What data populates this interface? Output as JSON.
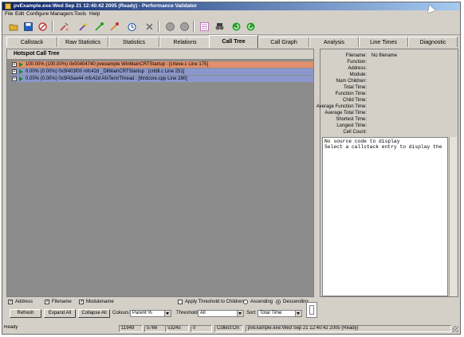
{
  "window": {
    "title": "pvExample.exe:Wed Sep 21 12:40:42 2005 (Ready) - Performance Validator"
  },
  "menu": [
    "File",
    "Edit",
    "Configure",
    "Managers",
    "Tools",
    "Help"
  ],
  "toolbar": {
    "buttons": [
      {
        "name": "open-icon",
        "color": "#e0b030"
      },
      {
        "name": "save-icon",
        "color": "#2060c0"
      },
      {
        "name": "launch-icon",
        "color": "#c03030"
      },
      {
        "name": "inject-icon",
        "color": "#c04040"
      },
      {
        "name": "wizard-icon",
        "color": "#6040a0"
      },
      {
        "name": "attach-icon",
        "color": "#20a020"
      },
      {
        "name": "attach-inject-icon",
        "color": "#e08020"
      },
      {
        "name": "timer-icon",
        "color": "#3060c0"
      },
      {
        "name": "pause-icon",
        "color": "#808080"
      },
      {
        "name": "stop-icon",
        "color": "#808080"
      },
      {
        "name": "settings-icon",
        "color": "#b060b0"
      },
      {
        "name": "find-icon",
        "color": "#404040"
      },
      {
        "name": "refresh-icon",
        "color": "#20a020"
      },
      {
        "name": "refresh-all-icon",
        "color": "#20a020"
      }
    ]
  },
  "tabs": [
    {
      "label": "Callstack",
      "active": false
    },
    {
      "label": "Raw Statistics",
      "active": false
    },
    {
      "label": "Statistics",
      "active": false
    },
    {
      "label": "Relations",
      "active": false
    },
    {
      "label": "Call Tree",
      "active": true
    },
    {
      "label": "Call Graph",
      "active": false
    },
    {
      "label": "Analysis",
      "active": false
    },
    {
      "label": "Line Times",
      "active": false
    },
    {
      "label": "Diagnostic",
      "active": false
    }
  ],
  "tree": {
    "header": "Hotspot Call Tree",
    "rows": [
      {
        "text": "100.00% (100.00%) 0x00404740 pvexample WinMainCRTStartup : [crtexe.c Line 175]",
        "color": "#e0906c"
      },
      {
        "text": "0.00% (0.00%) 0x5f403f00 mfc42d _DllMainCRTStartup : [crtdll.c Line 251]",
        "color": "#8c98cc"
      },
      {
        "text": "0.00% (0.00%) 0x5f43ae44 mfc42d AfxTermThread : [thrdcore.cpp Line 280]",
        "color": "#8c98cc"
      }
    ]
  },
  "details": {
    "labels": [
      "Filename:",
      "Function:",
      "Address:",
      "Module:",
      "Num Children:",
      "Total Time:",
      "Function Time:",
      "Child Time:",
      "Average Function Time:",
      "Average Total Time:",
      "Shortest Time:",
      "Longest Time:",
      "Cell Count:"
    ],
    "filename_value": "No filename",
    "source_lines": [
      "No source code to display",
      "Select a callstack entry to display the"
    ]
  },
  "controls": {
    "address_label": "Address",
    "filename_label": "Filename",
    "modulename_label": "Modulename",
    "refresh_label": "Refresh",
    "expand_all_label": "Expand All",
    "collapse_all_label": "Collapse All",
    "colours_label": "Colours:",
    "colours_value": "Parent %",
    "apply_threshold_label": "Apply Threshold to Children",
    "threshold_label": "Threshold",
    "threshold_value": "All",
    "ascending_label": "Ascending",
    "descending_label": "Descending",
    "sort_label": "Sort:",
    "sort_value": "Total Time"
  },
  "status": {
    "ready": "Ready",
    "count1": "11949",
    "count2": "5766",
    "count3": "53245",
    "count4": "0",
    "collect": "Collect:On",
    "session": "pvExample.exe:Wed Sep 21 12:40:42 2005 (Ready)"
  }
}
